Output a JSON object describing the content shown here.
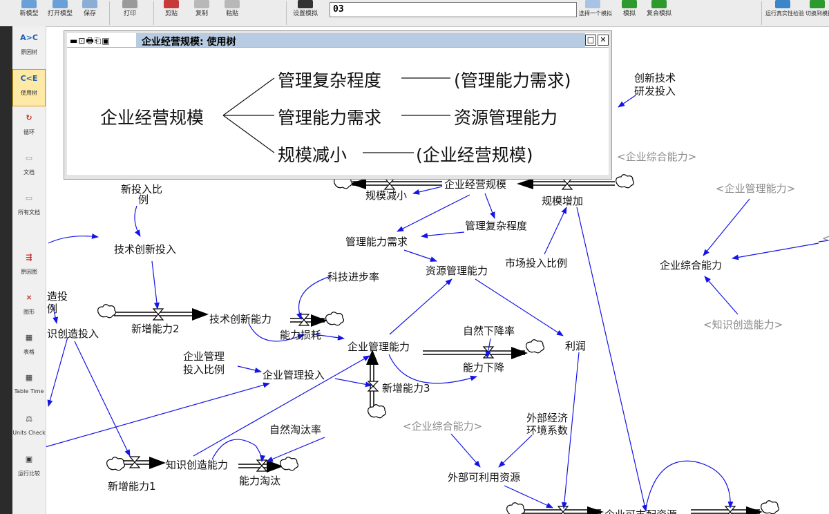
{
  "toolbar": {
    "buttons": [
      "新模型",
      "打开模型",
      "保存",
      "打印",
      "剪贴",
      "复制",
      "粘贴",
      "设置模拟",
      "选择一个模拟",
      "模拟",
      "复合模拟",
      "运行真实性检验",
      "切换到模拟"
    ],
    "model_name": "03"
  },
  "sidebar": {
    "items": [
      "原因树",
      "使用树",
      "循环",
      "文档",
      "所有文档",
      "原因图",
      "图形",
      "表格",
      "Table Time",
      "Units Check",
      "运行比较"
    ],
    "active_index": 1
  },
  "tree_window": {
    "title": "企业经营规模: 使用树",
    "title_icons": "▬⊡🖶⎗▣",
    "root": "企业经营规模",
    "rows": [
      {
        "mid": "管理复杂程度",
        "leaf": "(管理能力需求)"
      },
      {
        "mid": "管理能力需求",
        "leaf": "资源管理能力"
      },
      {
        "mid": "规模减小",
        "leaf": "(企业经营规模)"
      }
    ],
    "restore_btn": "□",
    "close_btn": "✕"
  },
  "diagram": {
    "labels": {
      "kj_cx_yf_1": "创新技术",
      "kj_cx_yf_2": "研发投入",
      "ghost_qyzhnl_top": "<企业综合能力>",
      "ghost_qyglnl": "<企业管理能力>",
      "ghost_zscznl": "<知识创造能力>",
      "ghost_qyzhnl_mid": "<企业综合能力>",
      "ghost_edge": "<",
      "gmjx": "规模减小",
      "qyjygm": "企业经营规模",
      "gmzj": "规模增加",
      "glfzcd": "管理复杂程度",
      "glnlxq": "管理能力需求",
      "zyglnl": "资源管理能力",
      "sctrbl": "市场投入比例",
      "qyzhnl": "企业综合能力",
      "kjjbl": "科技进步率",
      "jscxtr": "技术创新投入",
      "jscxnl": "技术创新能力",
      "xznl2": "新增能力2",
      "nlsh": "能力损耗",
      "qyglnl": "企业管理能力",
      "zrxjl": "自然下降率",
      "nlxj": "能力下降",
      "lr": "利润",
      "qyglbl_1": "企业管理",
      "qyglbl_2": "投入比例",
      "qygltr": "企业管理投入",
      "xznl3": "新增能力3",
      "xtrbl_1": "新投入比",
      "xtrbl_2": "例",
      "zztr_1": "造投",
      "zztr_2": "例",
      "zsczr": "识创造投入",
      "zrttl": "自然淘汰率",
      "zscznl": "知识创造能力",
      "nltt": "能力淘汰",
      "xznl1": "新增能力1",
      "wbjj_1": "外部经济",
      "wbjj_2": "环境系数",
      "wbklyzy": "外部可利用资源",
      "qykzpzy": "企业可支配资源"
    }
  },
  "colors": {
    "arrow": "#1414e6",
    "ghost": "#8a8a8a",
    "title_bar": "#b7cbe2",
    "active_tool": "#ffe9a6"
  }
}
